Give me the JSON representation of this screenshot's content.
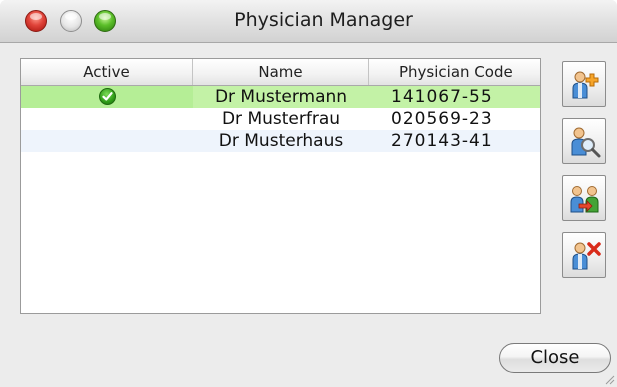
{
  "window": {
    "title": "Physician Manager"
  },
  "table": {
    "columns": [
      "Active",
      "Name",
      "Physician Code"
    ],
    "rows": [
      {
        "active": true,
        "name": "Dr Mustermann",
        "code": "141067-55",
        "selected": true
      },
      {
        "active": false,
        "name": "Dr Musterfrau",
        "code": "020569-23",
        "selected": false
      },
      {
        "active": false,
        "name": "Dr Musterhaus",
        "code": "270143-41",
        "selected": false
      }
    ]
  },
  "side_buttons": [
    {
      "icon": "add-user-icon"
    },
    {
      "icon": "search-user-icon"
    },
    {
      "icon": "transfer-user-icon"
    },
    {
      "icon": "delete-user-icon"
    }
  ],
  "footer": {
    "close_label": "Close"
  },
  "colors": {
    "selected_row": "#b5ee96",
    "alt_row": "#eef4fc",
    "active_check": "#2e9c17"
  }
}
